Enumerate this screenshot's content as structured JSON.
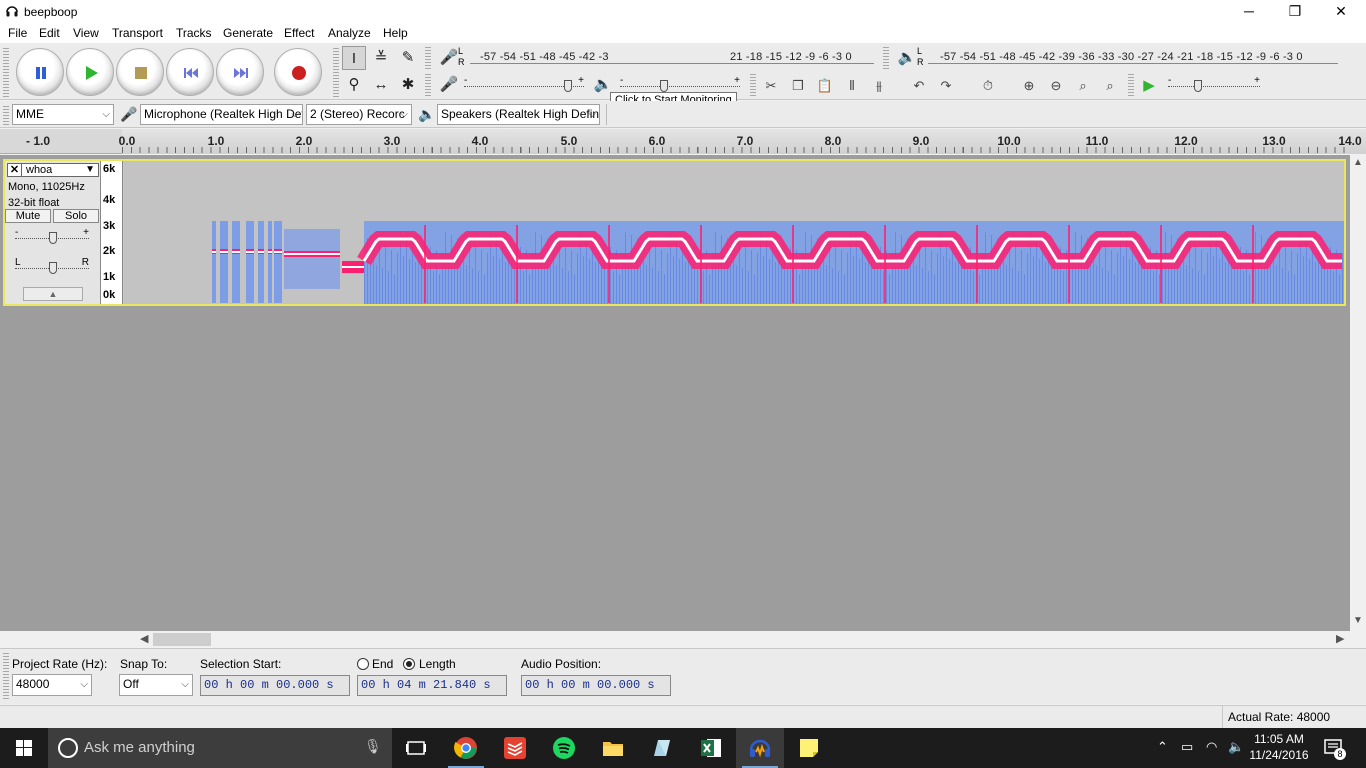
{
  "window": {
    "title": "beepboop",
    "minimize": "─",
    "maximize": "❐",
    "close": "✕"
  },
  "menu": [
    "File",
    "Edit",
    "View",
    "Transport",
    "Tracks",
    "Generate",
    "Effect",
    "Analyze",
    "Help"
  ],
  "meters": {
    "record_scale": "-57 -54 -51 -48 -45 -42 -3",
    "record_scale_tail": "21 -18 -15 -12  -9  -6  -3  0",
    "playback_scale": "-57 -54 -51 -48 -45 -42 -39 -36 -33 -30 -27 -24 -21 -18 -15 -12  -9  -6  -3  0",
    "tooltip": "Click to Start Monitoring",
    "record_lr_top": "L",
    "record_lr_bottom": "R",
    "playback_lr_top": "L",
    "playback_lr_bottom": "R"
  },
  "sliders": {
    "minus": "-",
    "plus": "+"
  },
  "devices": {
    "host": "MME",
    "microphone": "Microphone (Realtek High Def",
    "channels": "2 (Stereo) Recorc",
    "speakers": "Speakers (Realtek High Defini"
  },
  "ruler": {
    "labels": [
      "- 1.0",
      "0.0",
      "1.0",
      "2.0",
      "3.0",
      "4.0",
      "5.0",
      "6.0",
      "7.0",
      "8.0",
      "9.0",
      "10.0",
      "11.0",
      "12.0",
      "13.0",
      "14.0"
    ]
  },
  "track": {
    "close": "✕",
    "name": "whoa",
    "menu_arrow": "▼",
    "info1": "Mono, 11025Hz",
    "info2": "32-bit float",
    "mute": "Mute",
    "solo": "Solo",
    "gain_minus": "-",
    "gain_plus": "+",
    "pan_left": "L",
    "pan_right": "R",
    "collapse": "▲",
    "freq_labels": [
      "6k",
      "4k",
      "3k",
      "2k",
      "1k",
      "0k"
    ],
    "display": "spectrogram"
  },
  "selection": {
    "project_rate_label": "Project Rate (Hz):",
    "project_rate": "48000",
    "snap_label": "Snap To:",
    "snap_value": "Off",
    "start_label": "Selection Start:",
    "start_value": "00 h 00 m 00.000 s",
    "end_label": "End",
    "length_label": "Length",
    "length_value": "00 h 04 m 21.840 s",
    "position_label": "Audio Position:",
    "position_value": "00 h 00 m 00.000 s"
  },
  "status": {
    "actual_rate": "Actual Rate: 48000"
  },
  "taskbar": {
    "search_placeholder": "Ask me anything",
    "time": "11:05 AM",
    "date": "11/24/2016",
    "notifications": "8"
  },
  "colors": {
    "accent_track_border": "#e8e85c",
    "spectrogram_peak": "#ff1f6e",
    "spectrogram_core": "#ffffff",
    "spectrogram_low": "#4f86ff",
    "play_green": "#2fb52f",
    "record_red": "#cc2020"
  }
}
